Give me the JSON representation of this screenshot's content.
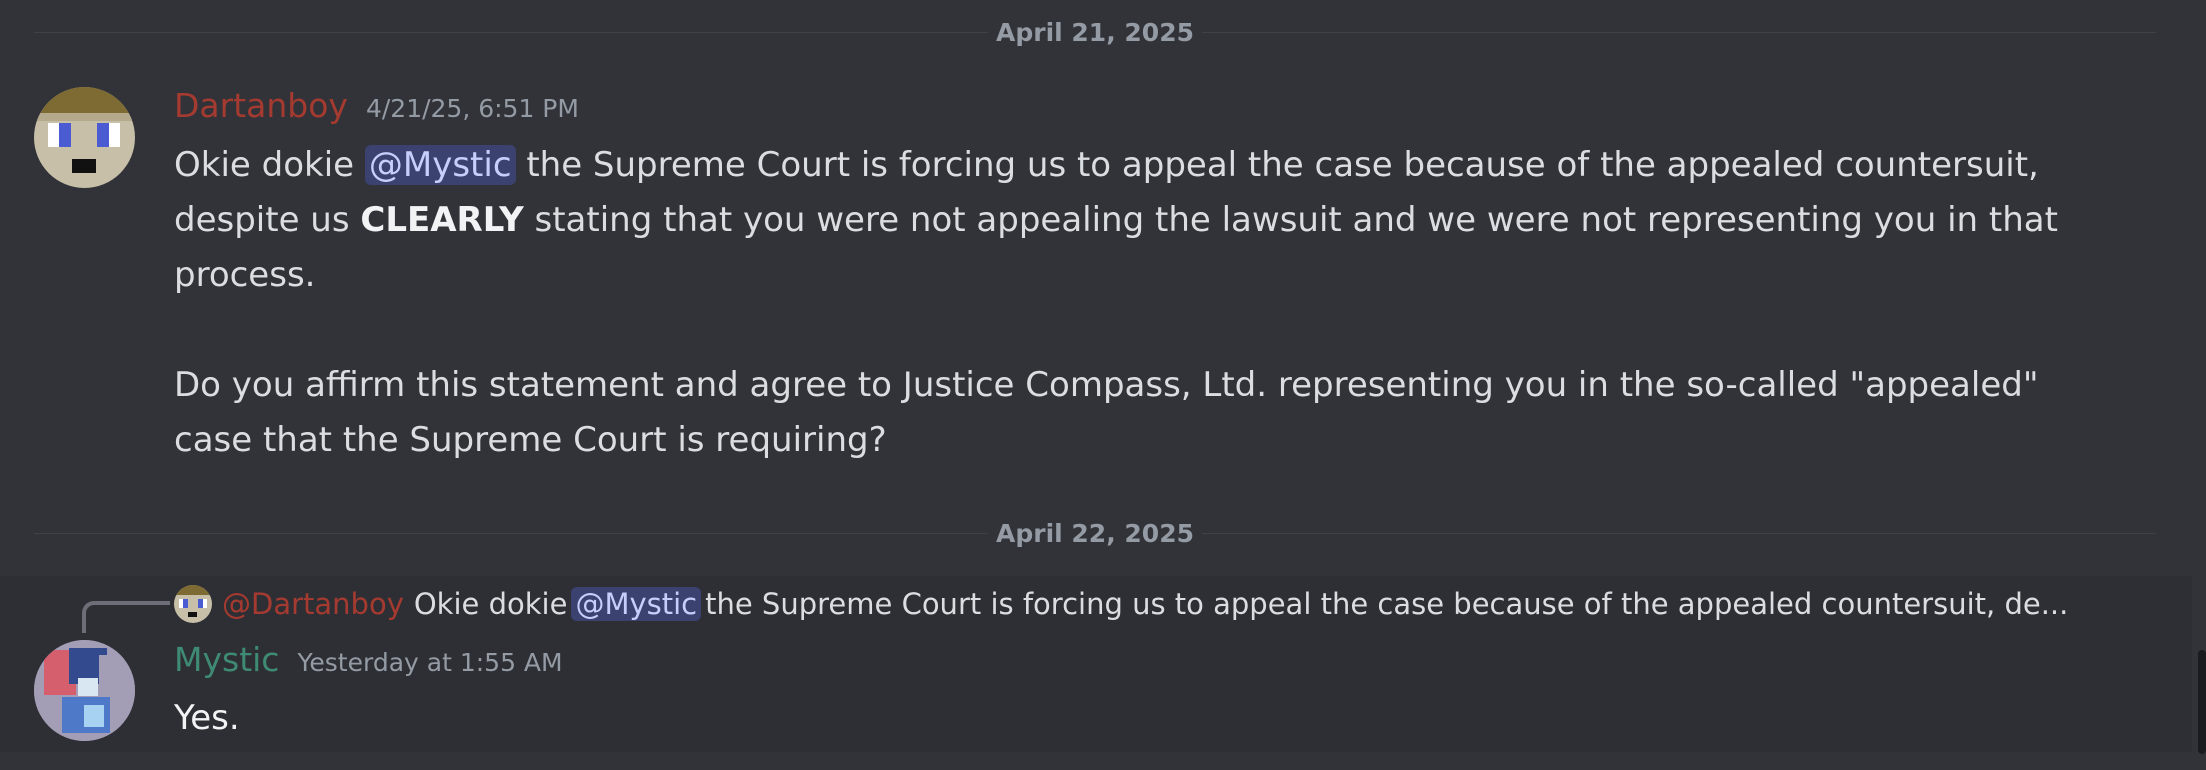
{
  "dividers": [
    {
      "label": "April 21, 2025"
    },
    {
      "label": "April 22, 2025"
    }
  ],
  "messages": [
    {
      "author": "Dartanboy",
      "timestamp": "4/21/25, 6:51 PM",
      "author_color": "#a53a30",
      "avatar_icon": "pixel-face-avatar",
      "line1_pre": "Okie dokie ",
      "mention": "@Mystic",
      "line1_post": " the Supreme Court is forcing us to appeal the case because of the appealed countersuit, despite us ",
      "bold": "CLEARLY",
      "line1_end": " stating that you were not appealing the lawsuit and we were not representing you in that process.",
      "paragraph2": "Do you affirm this statement and agree to Justice Compass, Ltd. representing you in the so-called \"appealed\" case that the Supreme Court is requiring?"
    },
    {
      "author": "Mystic",
      "timestamp": "Yesterday at 1:55 AM",
      "author_color": "#3f8a73",
      "avatar_icon": "pixel-character-avatar",
      "reply": {
        "author": "@Dartanboy",
        "text_pre": "Okie dokie",
        "mention": "@Mystic",
        "text_post": "the Supreme Court is forcing us to appeal the case because of the appealed countersuit, de..."
      },
      "body": "Yes."
    }
  ],
  "colors": {
    "background": "#313338",
    "hover_background": "#2e2f34",
    "mention_bg": "#3c4270",
    "mention_text": "#c9cdfb"
  }
}
